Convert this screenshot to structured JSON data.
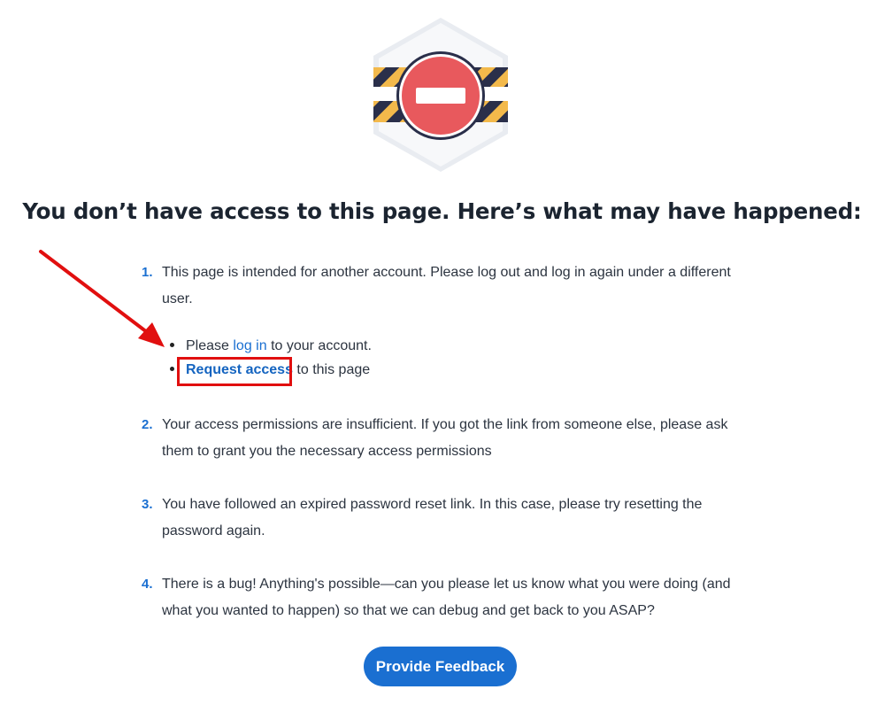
{
  "heading": "You don’t have access to this page. Here’s what may have happened:",
  "items": [
    {
      "number": "1.",
      "text": "This page is intended for another account. Please log out and log in again under a different user."
    },
    {
      "number": "2.",
      "text": "Your access permissions are insufficient. If you got the link from someone else, please ask them to grant you the necessary access permissions"
    },
    {
      "number": "3.",
      "text": "You have followed an expired password reset link. In this case, please try resetting the password again."
    },
    {
      "number": "4.",
      "text": "There is a bug! Anything's possible—can you please let us know what you were doing (and what you wanted to happen) so that we can debug and get back to you ASAP?"
    }
  ],
  "sub_items": {
    "login_prefix": "Please ",
    "login_link": "log in",
    "login_suffix": " to your account.",
    "request_link": "Request access",
    "request_suffix": " to this page"
  },
  "feedback_button": "Provide Feedback",
  "colors": {
    "accent": "#1a6fd1",
    "highlight": "#e10f0f",
    "stop_sign": "#e8595d"
  },
  "icons": {
    "main": "access-denied-icon",
    "annotation": "red-arrow-icon"
  }
}
